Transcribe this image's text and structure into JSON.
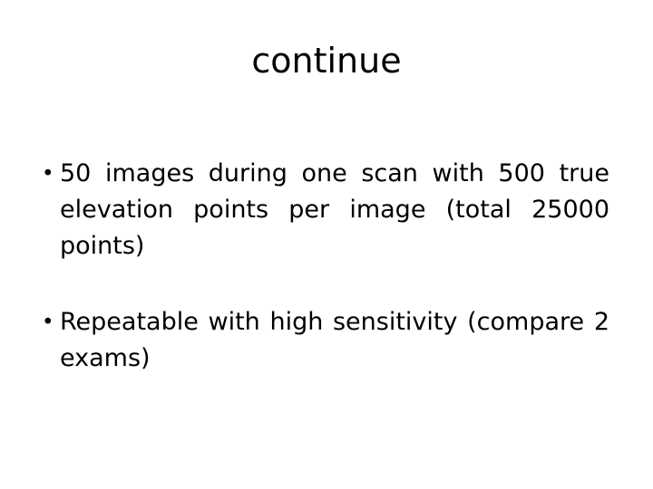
{
  "slide": {
    "title": "continue",
    "background_color": "#ffffff",
    "text_color": "#000000",
    "bullet_glyph": "•",
    "bullets": [
      {
        "marker": "•",
        "text": "50  images during one scan with 500 true elevation points per image (total 25000 points)"
      },
      {
        "marker": "•",
        "text": "Repeatable with high sensitivity (compare 2 exams)"
      }
    ]
  }
}
